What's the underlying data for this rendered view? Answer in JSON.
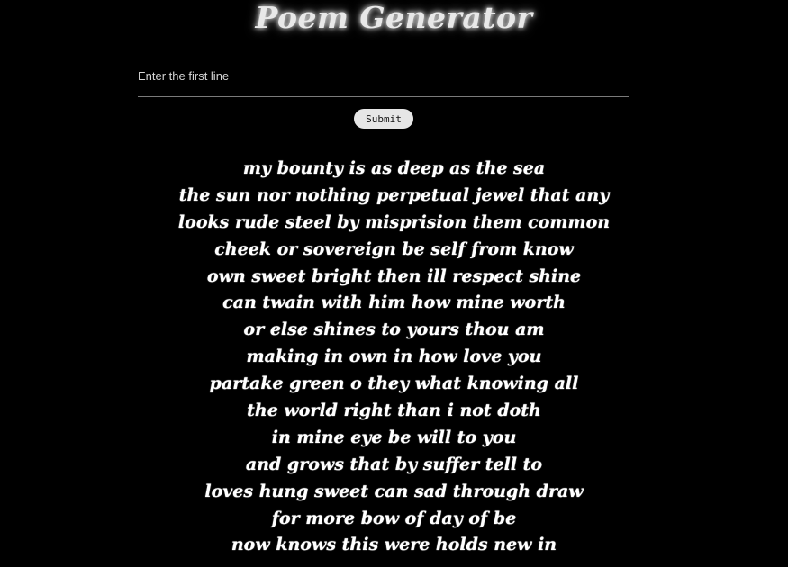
{
  "header": {
    "title": "Poem Generator"
  },
  "form": {
    "input_placeholder": "Enter the first line",
    "input_value": "",
    "submit_label": "Submit"
  },
  "poem": {
    "lines": [
      "my bounty is as deep as the sea",
      "the sun nor nothing perpetual jewel that any",
      "looks rude steel by misprision them common",
      "cheek or sovereign be self from know",
      "own sweet bright then ill respect shine",
      "can twain with him how mine worth",
      "or else shines to yours thou am",
      "making in own in how love you",
      "partake green o they what knowing all",
      "the world right than i not doth",
      "in mine eye be will to you",
      "and grows that by suffer tell to",
      "loves hung sweet can sad through draw",
      "for more bow of day of be",
      "now knows this were holds new in"
    ]
  }
}
